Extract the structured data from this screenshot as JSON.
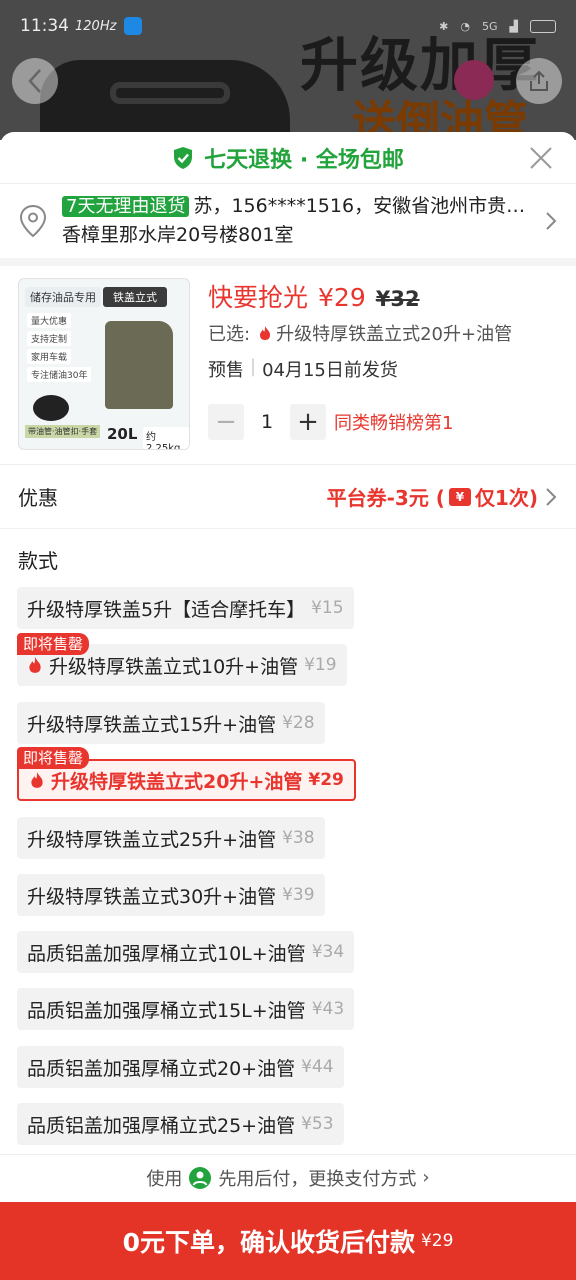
{
  "status_bar": {
    "time": "11:34",
    "refresh_rate": "120Hz",
    "network": "5G"
  },
  "background": {
    "banner_line1": "升级加厚",
    "banner_line2": "送倒油管"
  },
  "header": {
    "guarantee": "七天退换 · 全场包邮"
  },
  "address": {
    "tag": "7天无理由退货",
    "line1": "苏，156****1516，安徽省池州市贵…",
    "line2": "香樟里那水岸20号楼801室"
  },
  "product": {
    "thumb": {
      "tag_storage": "储存油品专用",
      "tag_type": "铁盖立式",
      "features": [
        "量大优惠",
        "支持定制",
        "家用车载",
        "专注储油30年"
      ],
      "volume": "20L",
      "weight": "约2.25kg",
      "bottom_tag": "带油管·油管扣·手套"
    },
    "rush_label": "快要抢光",
    "price": "¥29",
    "original_price": "¥32",
    "selected_prefix": "已选:",
    "selected_value": "升级特厚铁盖立式20升+油管",
    "presale_label": "预售",
    "presale_date": "04月15日前发货",
    "quantity": "1",
    "minus": "−",
    "plus": "+",
    "rank": "同类畅销榜第1"
  },
  "promo": {
    "label": "优惠",
    "value_main": "平台券-3元 (",
    "ticket_symbol": "¥",
    "value_tail": "仅1次)"
  },
  "styles": {
    "title": "款式",
    "options": [
      {
        "name": "升级特厚铁盖5升【适合摩托车】",
        "price": "¥15"
      },
      {
        "name": "升级特厚铁盖立式10升+油管",
        "price": "¥19",
        "badge": "即将售罄"
      },
      {
        "name": "升级特厚铁盖立式15升+油管",
        "price": "¥28"
      },
      {
        "name": "升级特厚铁盖立式20升+油管",
        "price": "¥29",
        "badge": "即将售罄",
        "selected": true
      },
      {
        "name": "升级特厚铁盖立式25升+油管",
        "price": "¥38"
      },
      {
        "name": "升级特厚铁盖立式30升+油管",
        "price": "¥39"
      },
      {
        "name": "品质铝盖加强厚桶立式10L+油管",
        "price": "¥34"
      },
      {
        "name": "品质铝盖加强厚桶立式15L+油管",
        "price": "¥43"
      },
      {
        "name": "品质铝盖加强厚桶立式20+油管",
        "price": "¥44"
      },
      {
        "name": "品质铝盖加强厚桶立式25+油管",
        "price": "¥53"
      }
    ]
  },
  "payment": {
    "prefix": "使用",
    "method": "先用后付，更换支付方式",
    "arrow": "›"
  },
  "submit": {
    "label": "0元下单，确认收货后付款",
    "amount": "¥29"
  },
  "colors": {
    "accent_red": "#e8362f",
    "green": "#23a33c",
    "submit_bg": "#e33427"
  }
}
